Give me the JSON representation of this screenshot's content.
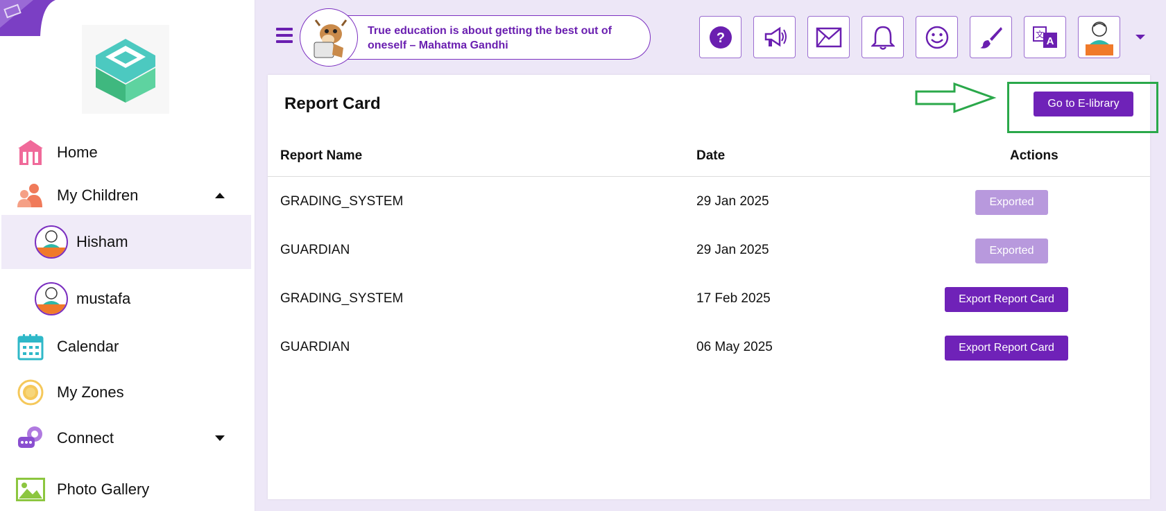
{
  "header": {
    "quote": "True education is about getting the best out of oneself – Mahatma Gandhi",
    "buttons": [
      {
        "name": "help-button",
        "icon": "question-icon"
      },
      {
        "name": "announcements-button",
        "icon": "megaphone-icon"
      },
      {
        "name": "messages-button",
        "icon": "mail-icon"
      },
      {
        "name": "notifications-button",
        "icon": "bell-icon"
      },
      {
        "name": "mood-button",
        "icon": "smiley-icon"
      },
      {
        "name": "theme-button",
        "icon": "brush-icon"
      },
      {
        "name": "language-button",
        "icon": "translate-icon"
      },
      {
        "name": "profile-button",
        "icon": "avatar-icon"
      }
    ]
  },
  "sidebar": {
    "home": "Home",
    "my_children": "My Children",
    "children": [
      "Hisham",
      "mustafa"
    ],
    "calendar": "Calendar",
    "my_zones": "My Zones",
    "connect": "Connect",
    "photo_gallery": "Photo Gallery"
  },
  "main": {
    "title": "Report Card",
    "elibrary_button": "Go to E-library",
    "columns": {
      "name": "Report Name",
      "date": "Date",
      "actions": "Actions"
    },
    "rows": [
      {
        "name": "GRADING_SYSTEM",
        "date": "29 Jan 2025",
        "action": "Exported",
        "status": "exported"
      },
      {
        "name": "GUARDIAN",
        "date": "29 Jan 2025",
        "action": "Exported",
        "status": "exported"
      },
      {
        "name": "GRADING_SYSTEM",
        "date": "17 Feb 2025",
        "action": "Export Report Card",
        "status": "pending"
      },
      {
        "name": "GUARDIAN",
        "date": "06 May 2025",
        "action": "Export Report Card",
        "status": "pending"
      }
    ]
  },
  "colors": {
    "accent": "#6f22b8",
    "accent_light": "#b899dd",
    "background": "#ede7f7",
    "annotation": "#2aa84a"
  }
}
